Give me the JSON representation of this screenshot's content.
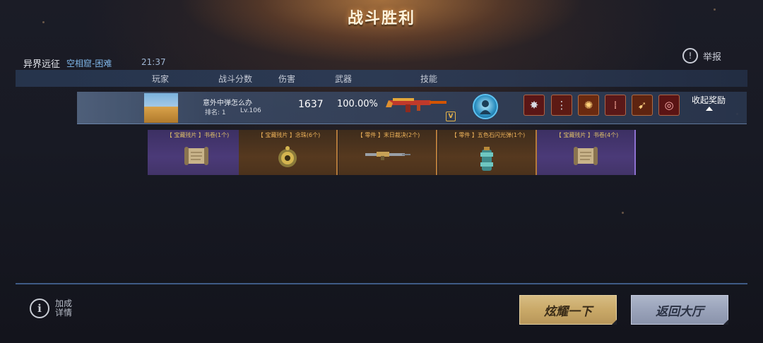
{
  "title": "战斗胜利",
  "match": {
    "mode": "异界远征",
    "map": "空相窟-困难",
    "time": "21:37"
  },
  "report_label": "举报",
  "columns": [
    "玩家",
    "战斗分数",
    "伤害",
    "武器",
    "技能"
  ],
  "player": {
    "name": "意外中弹怎么办",
    "rank": "排名: 1",
    "level": "Lv.106",
    "score": "1637",
    "damage": "100.00%",
    "collapse_label": "收起奖励"
  },
  "rewards": [
    {
      "label": "【 宝藏残片 】书卷(1个)",
      "style": "purple",
      "icon": "scroll-icon"
    },
    {
      "label": "【 宝藏残片 】念珠(6个)",
      "style": "orange",
      "icon": "bead-icon"
    },
    {
      "label": "【 零件 】末日裁决(2个)",
      "style": "orange",
      "icon": "rifle-part-icon"
    },
    {
      "label": "【 零件 】五色石闪光弹(1个)",
      "style": "orange",
      "icon": "grenade-part-icon"
    },
    {
      "label": "【 宝藏残片 】书卷(4个)",
      "style": "purple",
      "icon": "scroll-icon"
    }
  ],
  "bonus_label": "加成详情",
  "buttons": {
    "show_off": "炫耀一下",
    "back_lobby": "返回大厅"
  }
}
